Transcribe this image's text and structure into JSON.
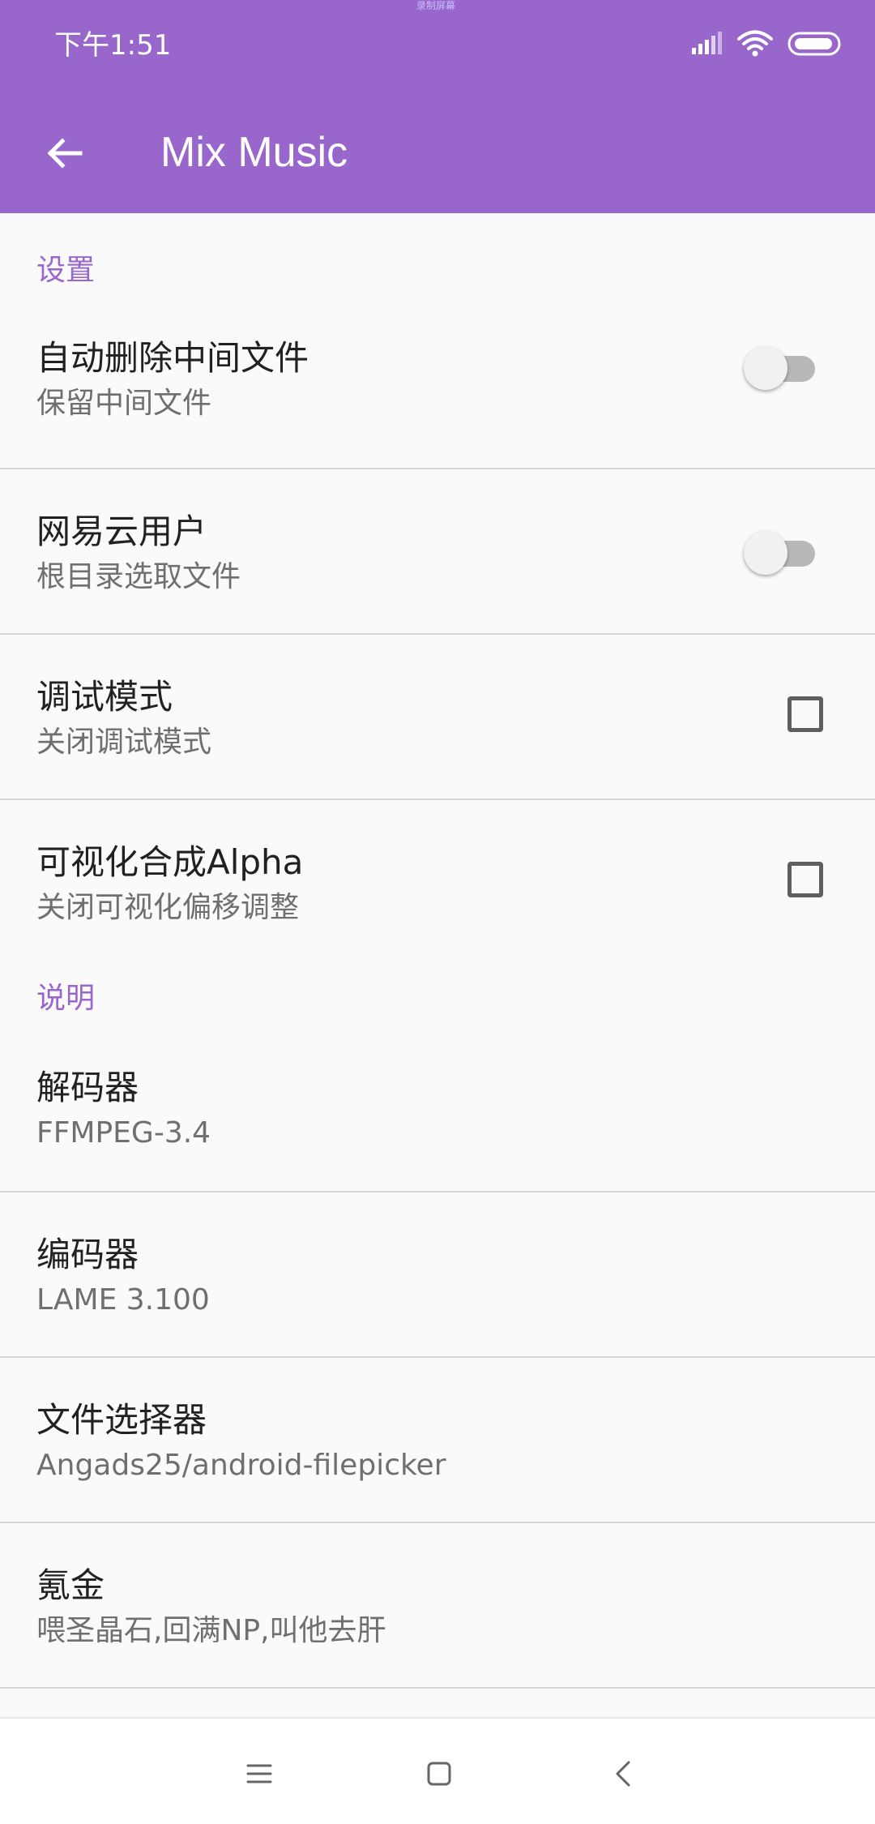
{
  "status": {
    "time": "下午1:51",
    "top_note": "录制屏幕"
  },
  "app_bar": {
    "title": "Mix Music"
  },
  "sections": {
    "settings": {
      "header": "设置",
      "items": [
        {
          "title": "自动删除中间文件",
          "summary": "保留中间文件",
          "control": "switch",
          "checked": false
        },
        {
          "title": "网易云用户",
          "summary": "根目录选取文件",
          "control": "switch",
          "checked": false
        },
        {
          "title": "调试模式",
          "summary": "关闭调试模式",
          "control": "checkbox",
          "checked": false
        },
        {
          "title": "可视化合成Alpha",
          "summary": "关闭可视化偏移调整",
          "control": "checkbox",
          "checked": false
        }
      ]
    },
    "about": {
      "header": "说明",
      "items": [
        {
          "title": "解码器",
          "summary": "FFMPEG-3.4"
        },
        {
          "title": "编码器",
          "summary": "LAME 3.100"
        },
        {
          "title": "文件选择器",
          "summary": "Angads25/android-filepicker"
        },
        {
          "title": "氪金",
          "summary": "喂圣晶石,回满NP,叫他去肝"
        }
      ]
    }
  },
  "nav": {
    "icons": [
      "menu-icon",
      "home-icon",
      "back-icon"
    ]
  },
  "colors": {
    "primary": "#9966cc",
    "background": "#fafafa",
    "title_text": "#212121",
    "summary_text": "#6f6f6f"
  }
}
